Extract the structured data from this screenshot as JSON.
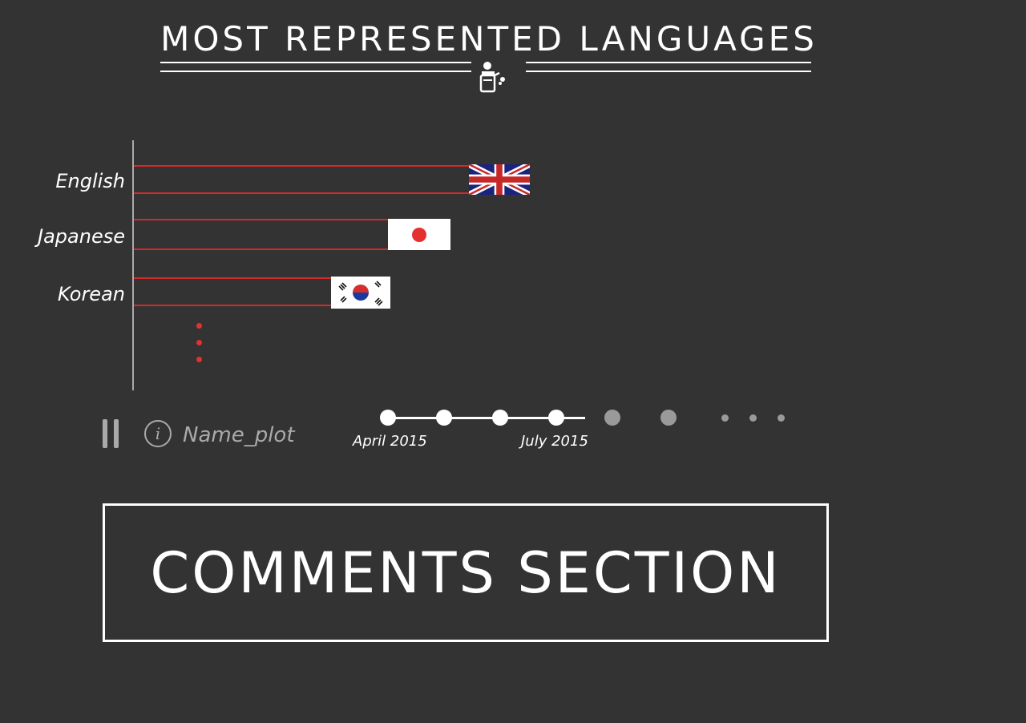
{
  "header": {
    "title": "MOST REPRESENTED LANGUAGES",
    "icon": "speaker-podium-icon"
  },
  "chart_data": {
    "type": "bar",
    "orientation": "horizontal",
    "categories": [
      "English",
      "Japanese",
      "Korean"
    ],
    "values": [
      100,
      76,
      59
    ],
    "series_marker": "flag",
    "flags": [
      "united-kingdom-flag",
      "japan-flag",
      "south-korea-flag"
    ],
    "bar_color": "#d22a2a",
    "more_indicator": true
  },
  "controls": {
    "pause_icon": "pause-icon",
    "info_icon": "info-icon",
    "plot_name": "Name_plot"
  },
  "timeline": {
    "labels": [
      {
        "text": "April 2015",
        "index": 0
      },
      {
        "text": "July 2015",
        "index": 3
      }
    ],
    "points_total": 6,
    "active_points": 4,
    "trailing_dots": 3,
    "active_color": "#ffffff",
    "inactive_color": "#9a9a9a"
  },
  "comments": {
    "label": "COMMENTS SECTION"
  }
}
